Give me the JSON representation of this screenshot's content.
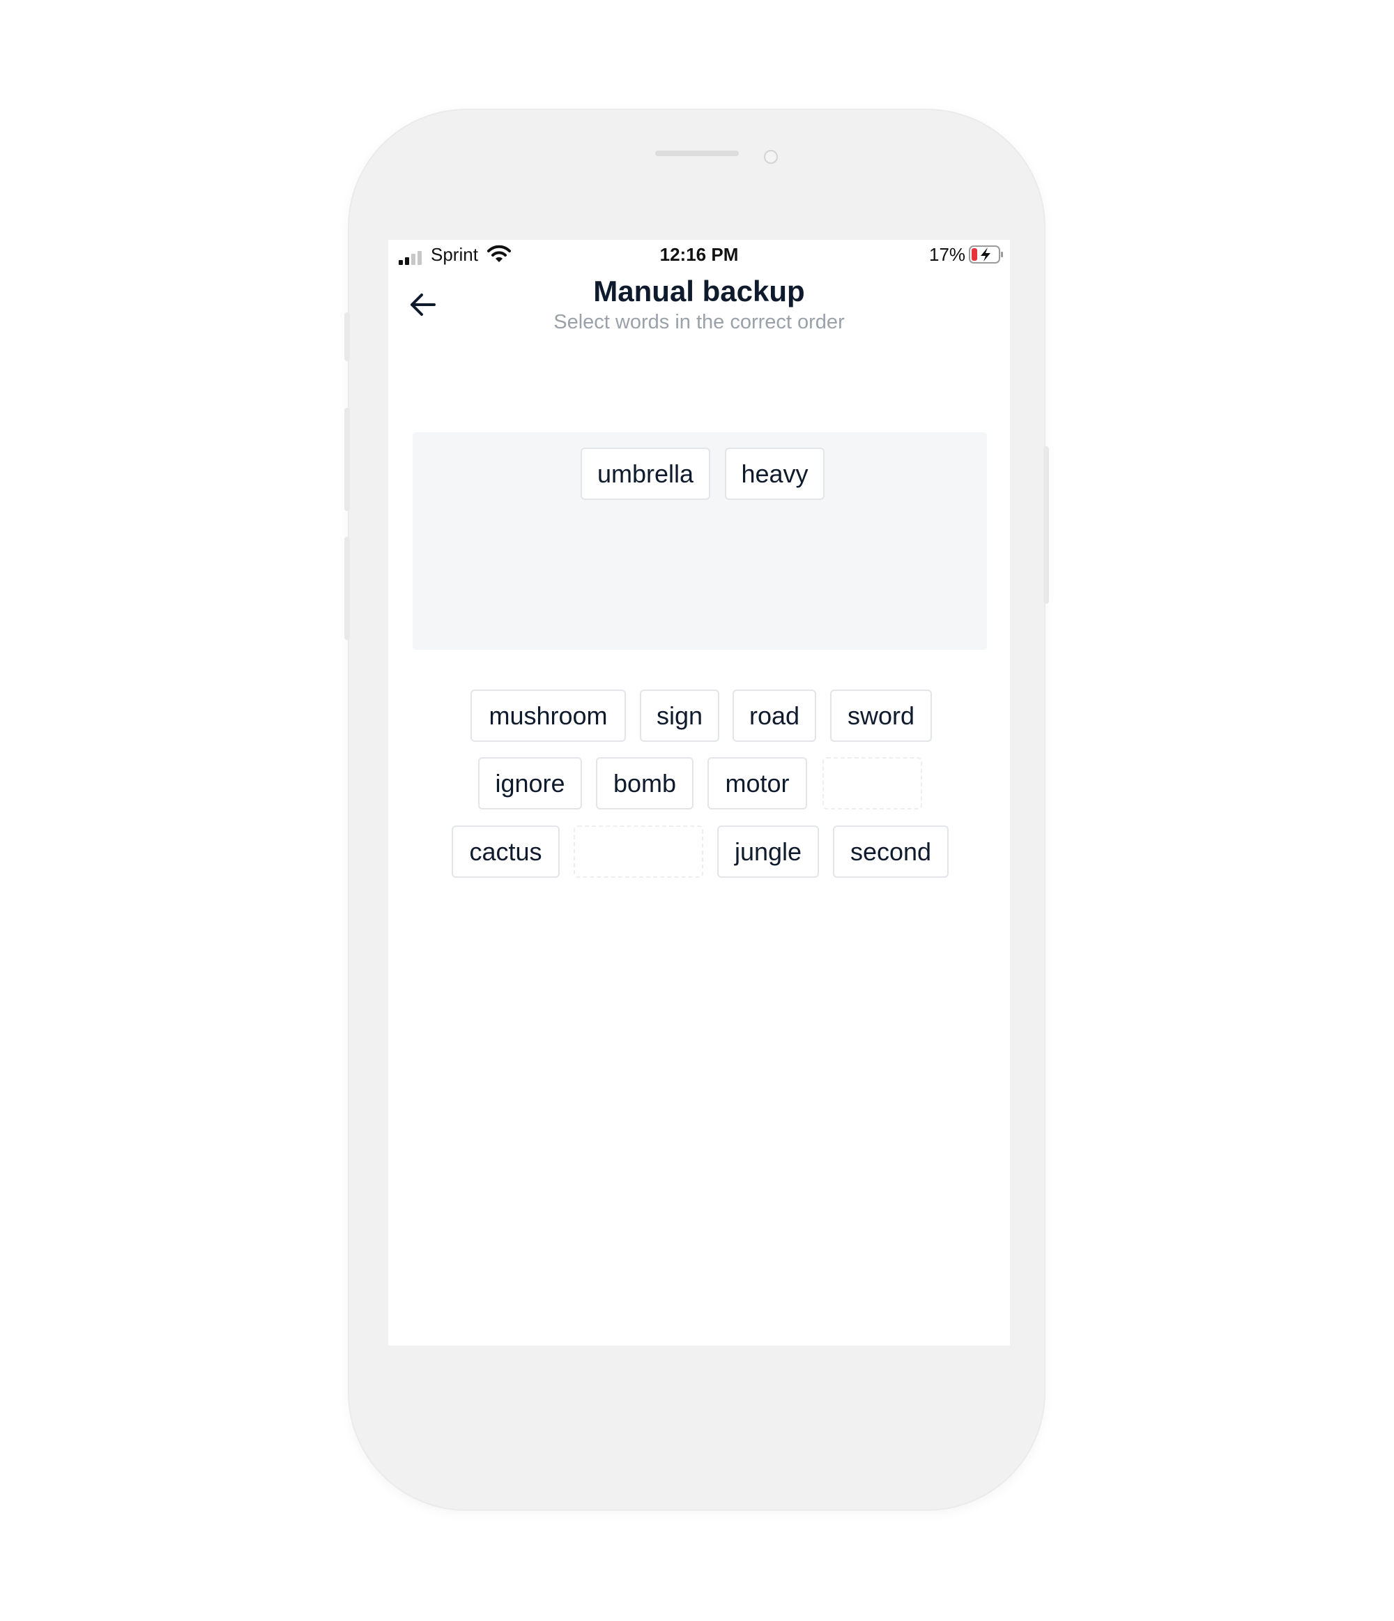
{
  "status_bar": {
    "carrier": "Sprint",
    "time": "12:16 PM",
    "battery_percent": "17%",
    "signal_bars_active": 2,
    "signal_bars_total": 4,
    "battery_level": 0.17,
    "battery_charging": true,
    "icons": [
      "signal-icon",
      "wifi-icon",
      "battery-charging-icon"
    ]
  },
  "header": {
    "title": "Manual backup",
    "subtitle": "Select words in the correct order",
    "back_icon": "arrow-left-icon"
  },
  "selected_words": [
    "umbrella",
    "heavy"
  ],
  "word_bank": {
    "rows": [
      [
        "mushroom",
        "sign",
        "road",
        "sword"
      ],
      [
        "ignore",
        "bomb",
        "motor",
        null
      ],
      [
        "cactus",
        null,
        "jungle",
        "second"
      ]
    ]
  },
  "colors": {
    "text_primary": "#0f1b2d",
    "text_secondary": "#9aa1a9",
    "answer_area_bg": "#f5f6f7",
    "chip_border": "#e3e5e8",
    "battery_low": "#e8333a"
  }
}
